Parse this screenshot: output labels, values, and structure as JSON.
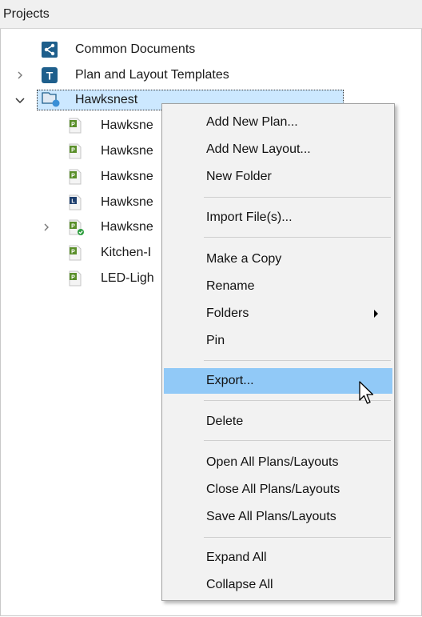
{
  "panel": {
    "title": "Projects"
  },
  "tree": {
    "common_documents": "Common Documents",
    "templates": "Plan and Layout Templates",
    "hawksnest": "Hawksnest",
    "children": [
      "Hawksne",
      "Hawksne",
      "Hawksne",
      "Hawksne",
      "Hawksne",
      "Kitchen-I",
      "LED-Ligh"
    ]
  },
  "menu": {
    "add_new_plan": "Add New Plan...",
    "add_new_layout": "Add New Layout...",
    "new_folder": "New Folder",
    "import_files": "Import File(s)...",
    "make_copy": "Make a Copy",
    "rename": "Rename",
    "folders": "Folders",
    "pin": "Pin",
    "export": "Export...",
    "delete": "Delete",
    "open_all": "Open All Plans/Layouts",
    "close_all": "Close All Plans/Layouts",
    "save_all": "Save All Plans/Layouts",
    "expand_all": "Expand All",
    "collapse_all": "Collapse All"
  },
  "colors": {
    "selection": "#cce8ff",
    "menu_highlight": "#91c9f7",
    "menu_bg": "#f2f2f2",
    "plan_icon": "#5a8f2a",
    "template_icon": "#1e5f8c"
  },
  "icons": {
    "common_documents": "share-icon",
    "templates": "template-t-icon",
    "hawksnest": "project-folder-icon",
    "plan_file": "plan-file-icon",
    "layout_file": "layout-file-icon",
    "submenu": "chevron-right-icon"
  }
}
